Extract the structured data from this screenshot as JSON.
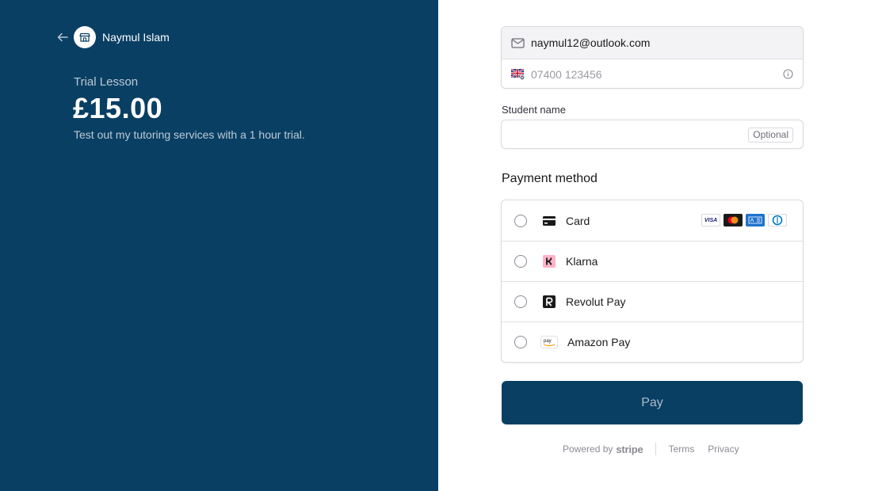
{
  "colors": {
    "brand": "#0a3f64"
  },
  "merchant": {
    "name": "Naymul Islam",
    "logo_icon": "store-icon"
  },
  "product": {
    "name": "Trial Lesson",
    "price": "£15.00",
    "description": "Test out my tutoring services with a 1 hour trial."
  },
  "contact": {
    "email": "naymul12@outlook.com",
    "phone_placeholder": "07400 123456",
    "country_flag": "uk-flag-icon"
  },
  "student": {
    "label": "Student name",
    "value": "",
    "optional_label": "Optional"
  },
  "payment": {
    "title": "Payment method",
    "methods": [
      {
        "label": "Card",
        "icon": "card-icon",
        "brands": [
          "VISA",
          "Mastercard",
          "AMEX",
          "Diners Club"
        ]
      },
      {
        "label": "Klarna",
        "icon": "klarna-icon"
      },
      {
        "label": "Revolut Pay",
        "icon": "revolut-icon"
      },
      {
        "label": "Amazon Pay",
        "icon": "amazon-pay-icon"
      }
    ]
  },
  "pay_button": {
    "label": "Pay"
  },
  "footer": {
    "powered_by": "Powered by",
    "stripe": "stripe",
    "terms": "Terms",
    "privacy": "Privacy"
  }
}
